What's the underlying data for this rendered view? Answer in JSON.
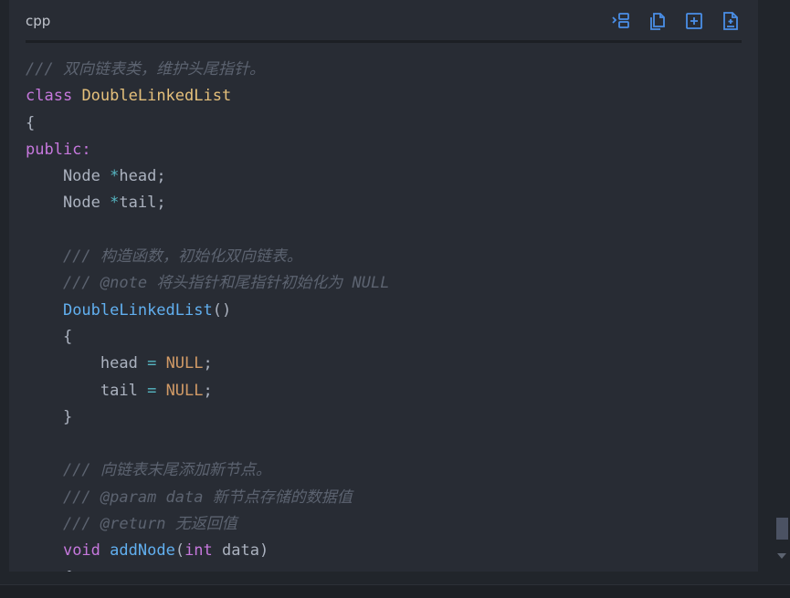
{
  "header": {
    "language": "cpp"
  },
  "icons": {
    "indent": "indent-icon",
    "copy": "copy-icon",
    "insert": "insert-icon",
    "new_file": "new-file-icon"
  },
  "colors": {
    "accent": "#4a8fe7",
    "comment": "#5c6370",
    "keyword": "#c678dd",
    "type": "#e5c07b",
    "function": "#61afef",
    "number": "#d19a66"
  },
  "code": {
    "lines": [
      [
        [
          "cm",
          "/// 双向链表类，维护头尾指针。"
        ]
      ],
      [
        [
          "kw",
          "class"
        ],
        [
          "pl",
          " "
        ],
        [
          "ty",
          "DoubleLinkedList"
        ]
      ],
      [
        [
          "pl",
          "{"
        ]
      ],
      [
        [
          "kw",
          "public:"
        ]
      ],
      [
        [
          "pl",
          "    Node "
        ],
        [
          "op",
          "*"
        ],
        [
          "pl",
          "head;"
        ]
      ],
      [
        [
          "pl",
          "    Node "
        ],
        [
          "op",
          "*"
        ],
        [
          "pl",
          "tail;"
        ]
      ],
      [],
      [
        [
          "pl",
          "    "
        ],
        [
          "cm",
          "/// 构造函数，初始化双向链表。"
        ]
      ],
      [
        [
          "pl",
          "    "
        ],
        [
          "cm",
          "/// @note 将头指针和尾指针初始化为 NULL"
        ]
      ],
      [
        [
          "pl",
          "    "
        ],
        [
          "fn",
          "DoubleLinkedList"
        ],
        [
          "pl",
          "()"
        ]
      ],
      [
        [
          "pl",
          "    {"
        ]
      ],
      [
        [
          "pl",
          "        head "
        ],
        [
          "op",
          "="
        ],
        [
          "pl",
          " "
        ],
        [
          "nu",
          "NULL"
        ],
        [
          "pl",
          ";"
        ]
      ],
      [
        [
          "pl",
          "        tail "
        ],
        [
          "op",
          "="
        ],
        [
          "pl",
          " "
        ],
        [
          "nu",
          "NULL"
        ],
        [
          "pl",
          ";"
        ]
      ],
      [
        [
          "pl",
          "    }"
        ]
      ],
      [],
      [
        [
          "pl",
          "    "
        ],
        [
          "cm",
          "/// 向链表末尾添加新节点。"
        ]
      ],
      [
        [
          "pl",
          "    "
        ],
        [
          "cm",
          "/// @param data 新节点存储的数据值"
        ]
      ],
      [
        [
          "pl",
          "    "
        ],
        [
          "cm",
          "/// @return 无返回值"
        ]
      ],
      [
        [
          "pl",
          "    "
        ],
        [
          "kw",
          "void"
        ],
        [
          "pl",
          " "
        ],
        [
          "fn",
          "addNode"
        ],
        [
          "pl",
          "("
        ],
        [
          "kw",
          "int"
        ],
        [
          "pl",
          " data)"
        ]
      ],
      [
        [
          "pl",
          "    {"
        ]
      ]
    ]
  }
}
